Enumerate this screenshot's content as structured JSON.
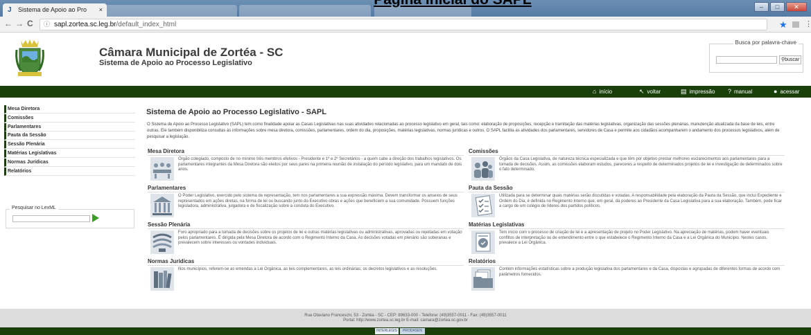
{
  "doc_heading": "Página inicial do SAPL",
  "browser": {
    "tab_title": "Sistema de Apoio ao Pro",
    "tab_close": "×",
    "url_host": "sapl.zortea.sc.leg.br",
    "url_path": "/default_index_html"
  },
  "site": {
    "title": "Câmara Municipal de Zortéa - SC",
    "subtitle": "Sistema de Apoio ao Processo Legislativo"
  },
  "search": {
    "legend": "Busca por palavra-chave",
    "button": "buscar"
  },
  "menubar": [
    {
      "label": "início",
      "icon": "home-icon"
    },
    {
      "label": "voltar",
      "icon": "back-arrow-icon"
    },
    {
      "label": "impressão",
      "icon": "print-icon"
    },
    {
      "label": "manual",
      "icon": "help-icon"
    },
    {
      "label": "acessar",
      "icon": "user-icon"
    }
  ],
  "sidebar": [
    "Mesa Diretora",
    "Comissões",
    "Parlamentares",
    "Pauta da Sessão",
    "Sessão Plenária",
    "Matérias Legislativas",
    "Normas Jurídicas",
    "Relatórios"
  ],
  "lexml": {
    "legend": "Pesquisar no LexML"
  },
  "main": {
    "title": "Sistema de Apoio ao Processo Legislativo - SAPL",
    "intro": "O Sistema de Apoio ao Processo Legislativo (SAPL) tem como finalidade apoiar as Casas Legislativas nas suas atividades relacionadas ao processo legislativo em geral, tais como: elaboração de proposições, recepção e tramitação das matérias legislativas, organização das sessões plenárias, manutenção atualizada da base de leis, entre outras. Ele também disponibiliza consultas às informações sobre mesa diretora, comissões, parlamentares, ordem do dia, proposições, matérias legislativas, normas jurídicas e outros. O SAPL facilita as atividades dos parlamentares, servidores de Casa e permite aos cidadãos acompanharem o andamento dos processos legislativos, além de pesquisar a legislação.",
    "sections": [
      {
        "title": "Mesa Diretora",
        "icon": "meeting-table-icon",
        "text": "Órgão colegiado, composto de no mínimo três membros efetivos - Presidente e 1º e 2º Secretários - a quem cabe a direção dos trabalhos legislativos. Os parlamentares integrantes da Mesa Diretora são eleitos por seus pares na primeira reunião de instalação do período legislativo, para um mandato de dois anos."
      },
      {
        "title": "Comissões",
        "icon": "people-group-icon",
        "text": "Órgãos da Casa Legislativa, de natureza técnica especializada e que têm por objetivo prestar melhores esclarecimentos aos parlamentares para a tomada de decisões. Assim, as comissões elaboram estudos, pareceres a respeito de determinados projetos de lei e investigação de determinados sobre o fato determinado."
      },
      {
        "title": "Parlamentares",
        "icon": "parliament-building-icon",
        "text": "O Poder Legislativo, exercido pelo sistema de representação, tem nos parlamentares a sua expressão máxima. Devem transformar os anseios de seus representados em ações diretas, na forma de lei ou buscando junto do Executivo obras e ações que beneficiem a sua comunidade. Possuem funções legisladora, administrativa, julgadora e de fiscalização sobre a conduta do Executivo."
      },
      {
        "title": "Pauta da Sessão",
        "icon": "checklist-icon",
        "text": "Utilizada para se determinar quais matérias serão discutidas e votadas. A responsabilidade pela elaboração da Pauta da Sessão, que inclui Expediente e Ordem do Dia, é definida no Regimento Interno que, em geral, dá poderes ao Presidente da Casa Legislativa para a sua elaboração. Também, pode ficar a cargo de um colégio de líderes dos partidos políticos."
      },
      {
        "title": "Sessão Plenária",
        "icon": "plenary-hall-icon",
        "text": "Foro apropriado para a tomada de decisões sobre os projetos de lei e outras matérias legislativas ou administrativas, aprovadas ou rejeitadas em votação pelos parlamentares. É dirigida pela Mesa Diretora de acordo com o Regimento Interno da Casa. As decisões votadas em plenário são soberanas e prevalecem sobre interesses ou vontades individuais."
      },
      {
        "title": "Matérias Legislativas",
        "icon": "document-seal-icon",
        "text": "Tem início com o processo de criação de lei e a apresentação de projeto no Poder Legislativo. Na apreciação de matérias, podem haver eventuais conflitos de interpretação ou de entendimento entre o que estabelece o Regimento Interno da Casa e a Lei Orgânica do Município. Nestes casos, prevalece a Lei Orgânica."
      },
      {
        "title": "Normas Jurídicas",
        "icon": "books-icon",
        "text": "Nos municípios, referem-se as emendas à Lei Orgânica, as leis complementares, as leis ordinárias, os decretos legislativos e as resoluções."
      },
      {
        "title": "Relatórios",
        "icon": "folder-documents-icon",
        "text": "Contém informações estatísticas sobre a produção legislativa dos parlamentares e da Casa, dispostas e agrupadas de diferentes formas de acordo com parâmetros fornecidos."
      }
    ]
  },
  "footer": {
    "line1": "Rua Otaviano Franceschi, 53 - Zortéa - SC - CEP: 89633-000 - Telefone: (49)3557-0011 - Fax: (49)3557-0011",
    "line2": "Portal: http://www.zortea.sc.leg.br E-mail: camara@zortea.sc.gov.br",
    "badge1": "INTERLEGIS",
    "badge2": "PRODASEN"
  },
  "colors": {
    "dark_green": "#1a3f0b",
    "tab_bar": "#557aa3"
  }
}
